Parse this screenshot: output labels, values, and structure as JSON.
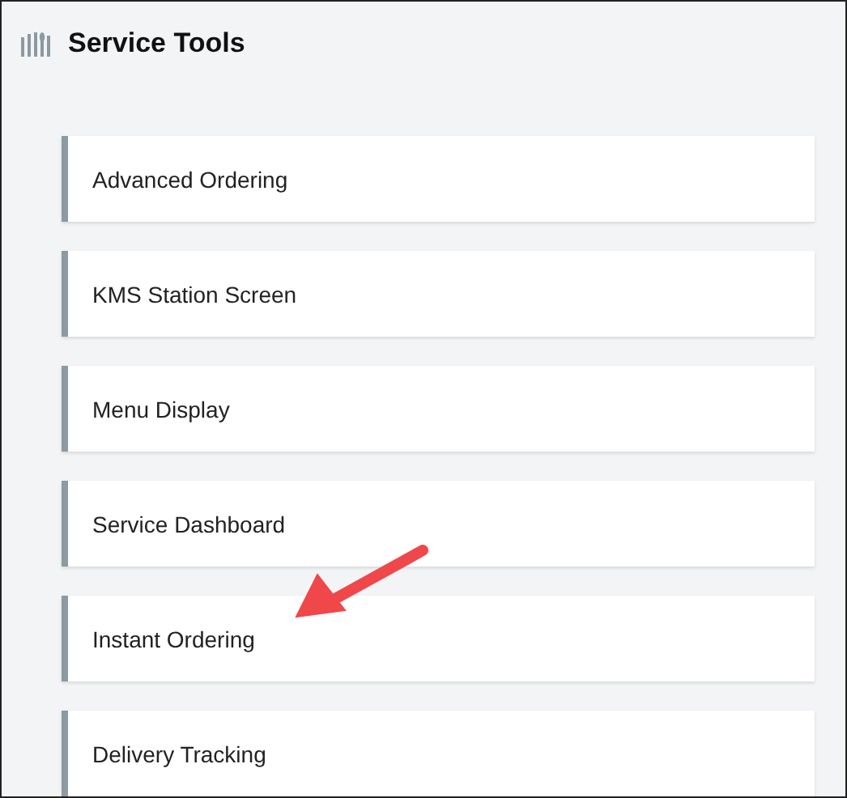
{
  "header": {
    "title": "Service Tools"
  },
  "tools": [
    {
      "label": "Advanced Ordering"
    },
    {
      "label": "KMS Station Screen"
    },
    {
      "label": "Menu Display"
    },
    {
      "label": "Service Dashboard"
    },
    {
      "label": "Instant Ordering"
    },
    {
      "label": "Delivery Tracking"
    }
  ]
}
